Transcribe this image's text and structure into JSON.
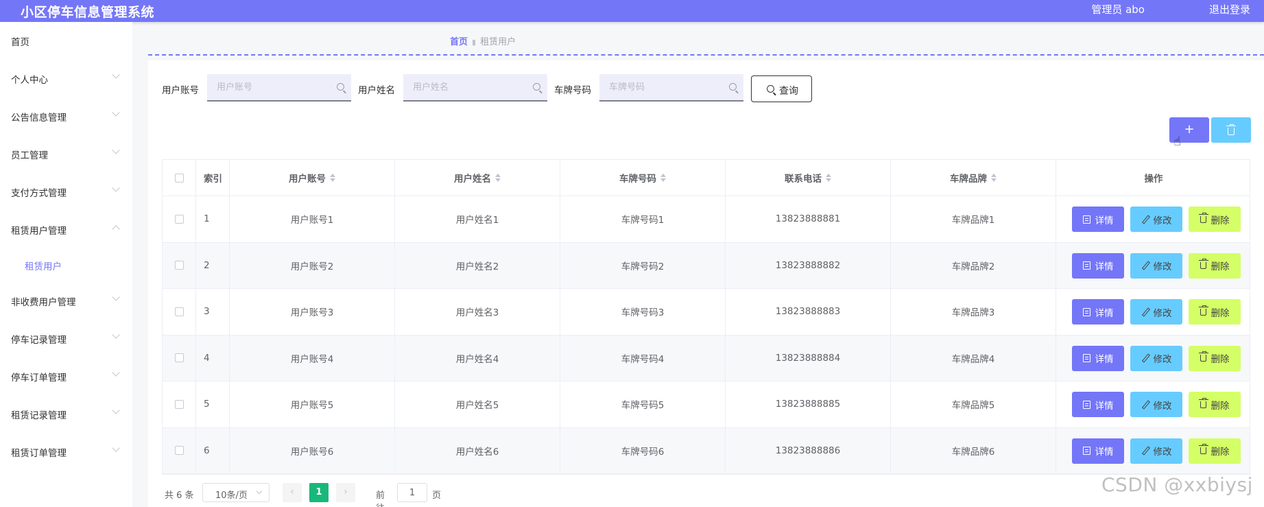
{
  "header": {
    "title": "小区停车信息管理系统",
    "user": "管理员 abo",
    "logout": "退出登录"
  },
  "sidebar": {
    "items": [
      {
        "label": "首页",
        "expandable": false
      },
      {
        "label": "个人中心",
        "expandable": true
      },
      {
        "label": "公告信息管理",
        "expandable": true
      },
      {
        "label": "员工管理",
        "expandable": true
      },
      {
        "label": "支付方式管理",
        "expandable": true
      },
      {
        "label": "租赁用户管理",
        "expandable": true,
        "expanded": true
      },
      {
        "label": "租赁用户",
        "sub": true,
        "active": true
      },
      {
        "label": "非收费用户管理",
        "expandable": true
      },
      {
        "label": "停车记录管理",
        "expandable": true
      },
      {
        "label": "停车订单管理",
        "expandable": true
      },
      {
        "label": "租赁记录管理",
        "expandable": true
      },
      {
        "label": "租赁订单管理",
        "expandable": true
      }
    ]
  },
  "breadcrumb": {
    "home": "首页",
    "current": "租赁用户"
  },
  "search": {
    "fields": [
      {
        "label": "用户账号",
        "placeholder": "用户账号",
        "value": ""
      },
      {
        "label": "用户姓名",
        "placeholder": "用户姓名",
        "value": ""
      },
      {
        "label": "车牌号码",
        "placeholder": "车牌号码",
        "value": ""
      }
    ],
    "query_label": "查询"
  },
  "toolbar": {
    "add_label": "+"
  },
  "table": {
    "columns": [
      "索引",
      "用户账号",
      "用户姓名",
      "车牌号码",
      "联系电话",
      "车牌品牌",
      "操作"
    ],
    "rows": [
      {
        "index": "1",
        "account": "用户账号1",
        "name": "用户姓名1",
        "plate": "车牌号码1",
        "phone": "13823888881",
        "brand": "车牌品牌1"
      },
      {
        "index": "2",
        "account": "用户账号2",
        "name": "用户姓名2",
        "plate": "车牌号码2",
        "phone": "13823888882",
        "brand": "车牌品牌2"
      },
      {
        "index": "3",
        "account": "用户账号3",
        "name": "用户姓名3",
        "plate": "车牌号码3",
        "phone": "13823888883",
        "brand": "车牌品牌3"
      },
      {
        "index": "4",
        "account": "用户账号4",
        "name": "用户姓名4",
        "plate": "车牌号码4",
        "phone": "13823888884",
        "brand": "车牌品牌4"
      },
      {
        "index": "5",
        "account": "用户账号5",
        "name": "用户姓名5",
        "plate": "车牌号码5",
        "phone": "13823888885",
        "brand": "车牌品牌5"
      },
      {
        "index": "6",
        "account": "用户账号6",
        "name": "用户姓名6",
        "plate": "车牌号码6",
        "phone": "13823888886",
        "brand": "车牌品牌6"
      }
    ],
    "actions": {
      "detail": "详情",
      "edit": "修改",
      "delete": "删除"
    }
  },
  "pagination": {
    "total": "共 6 条",
    "page_size": "10条/页",
    "current_page": "1",
    "goto_prefix": "前往",
    "goto_value": "1",
    "goto_suffix": "页",
    "prev": "‹",
    "next": "›"
  },
  "watermark": "CSDN @xxbiysj",
  "colors": {
    "accent": "#7476f8",
    "info": "#66ccff",
    "warning": "#d4ff66",
    "active_page": "#18b87a"
  }
}
